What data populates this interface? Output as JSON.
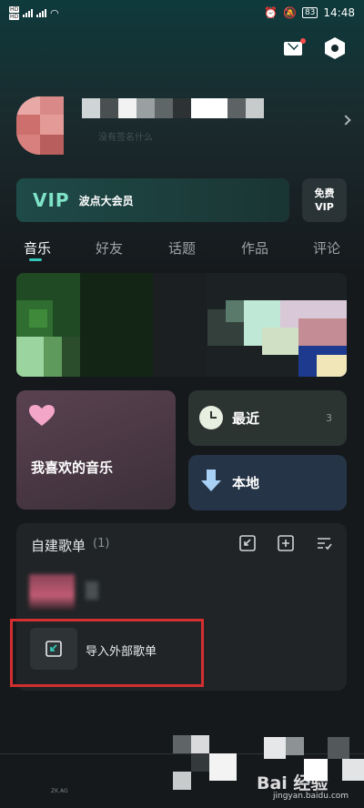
{
  "status_bar": {
    "time": "14:48",
    "battery": "83"
  },
  "header": {
    "icons": [
      "mail-icon",
      "settings-icon"
    ]
  },
  "profile": {
    "subtitle": "没有签名什么"
  },
  "vip": {
    "logo": "VIP",
    "label": "波点大会员",
    "free_line1": "免费",
    "free_line2": "VIP"
  },
  "tabs": [
    {
      "label": "音乐",
      "active": true
    },
    {
      "label": "好友",
      "active": false
    },
    {
      "label": "话题",
      "active": false
    },
    {
      "label": "作品",
      "active": false
    },
    {
      "label": "评论",
      "active": false
    }
  ],
  "cards": {
    "favorite": "我喜欢的音乐",
    "recent": {
      "label": "最近",
      "count": "3"
    },
    "local": "本地"
  },
  "playlist": {
    "title": "自建歌单",
    "count": "(1)",
    "import_label": "导入外部歌单"
  },
  "bottom": {
    "small_text": "ZK.AG",
    "watermark": "Bai 经验",
    "watermark_sub": "jingyan.baidu.com"
  },
  "colors": {
    "accent": "#33c5b7",
    "vip_green": "#7fe3c7",
    "highlight": "#d32f2f"
  }
}
